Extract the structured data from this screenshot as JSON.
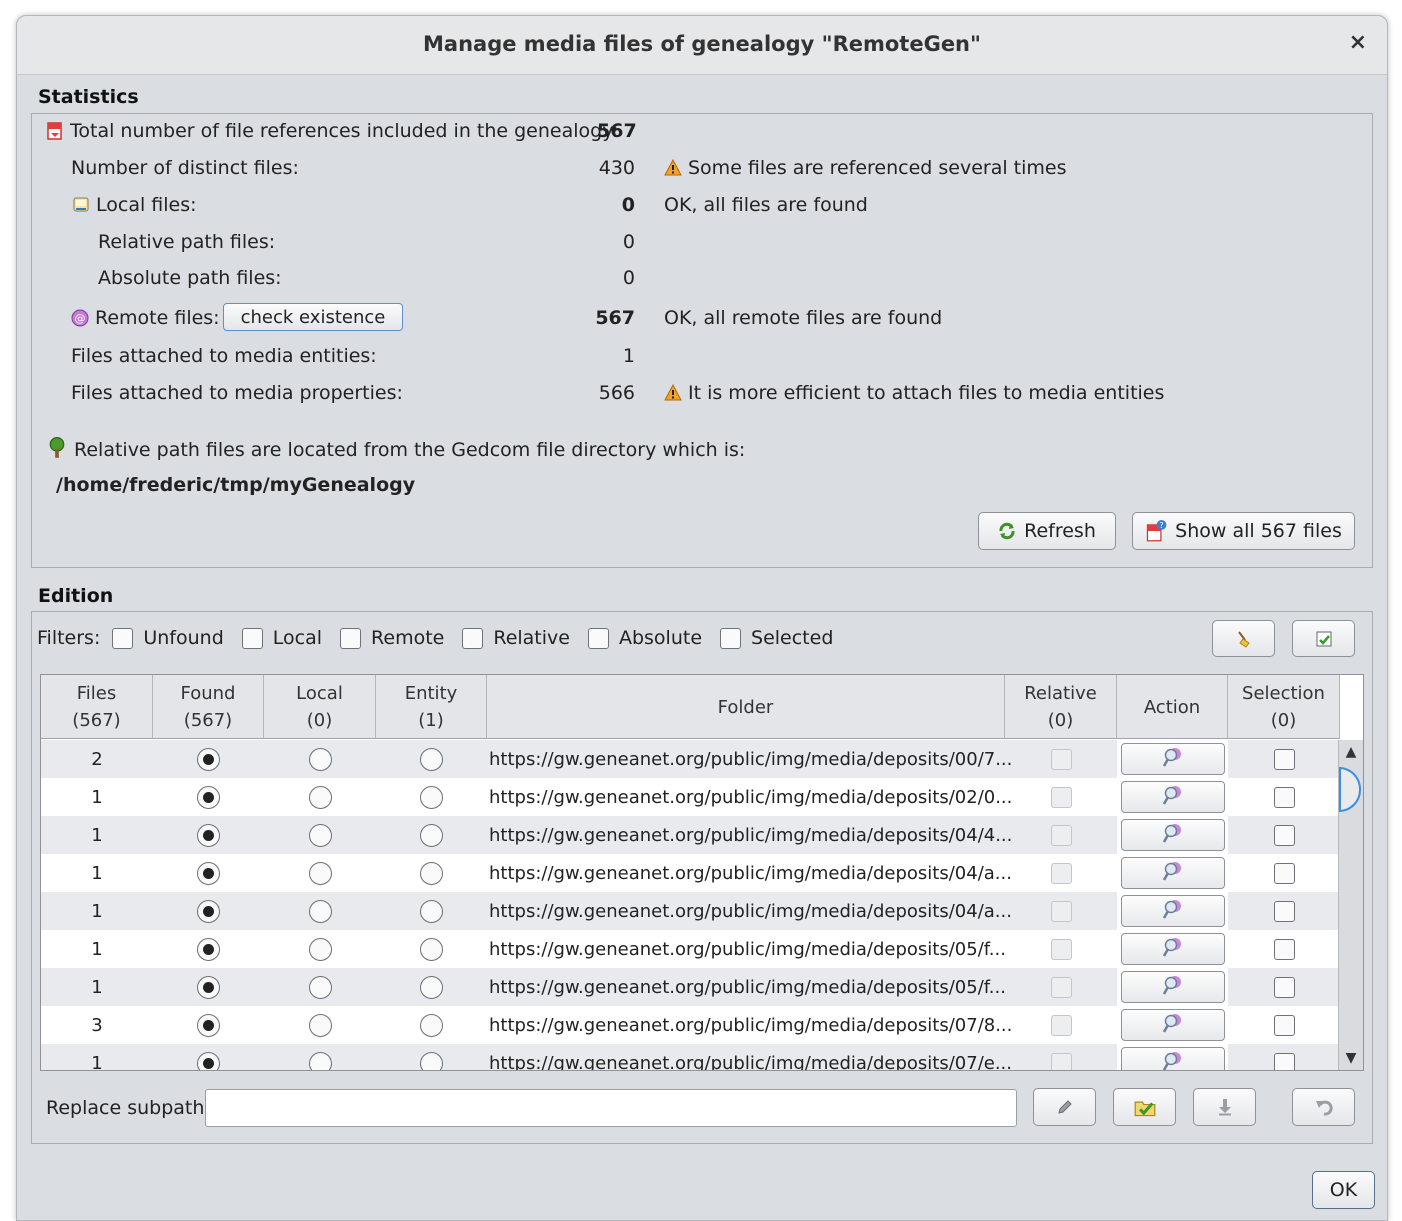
{
  "window": {
    "title": "Manage media files of genealogy \"RemoteGen\"",
    "close_glyph": "×"
  },
  "statistics": {
    "section_title": "Statistics",
    "total": {
      "label": "Total number of file references included in the genealogy:",
      "value": "567"
    },
    "distinct": {
      "label": "Number of distinct files:",
      "value": "430",
      "note": "Some files are referenced several times"
    },
    "local": {
      "label": "Local files:",
      "value": "0",
      "note": "OK, all files are found"
    },
    "relative": {
      "label": "Relative path files:",
      "value": "0"
    },
    "absolute": {
      "label": "Absolute path files:",
      "value": "0"
    },
    "remote": {
      "label": "Remote files:",
      "button": "check existence",
      "value": "567",
      "note": "OK, all remote files are found"
    },
    "entities": {
      "label": "Files attached to media entities:",
      "value": "1"
    },
    "properties": {
      "label": "Files attached to media properties:",
      "value": "566",
      "note": "It is more efficient to attach files to media entities"
    },
    "gedcom_note": "Relative path files are located from the Gedcom file directory which is:",
    "gedcom_dir": "/home/frederic/tmp/myGenealogy",
    "refresh_label": "Refresh",
    "show_all_label": "Show all 567 files"
  },
  "edition": {
    "section_title": "Edition",
    "filters_label": "Filters:",
    "filters": [
      "Unfound",
      "Local",
      "Remote",
      "Relative",
      "Absolute",
      "Selected"
    ],
    "columns": [
      {
        "name": "Files",
        "count": "(567)"
      },
      {
        "name": "Found",
        "count": "(567)"
      },
      {
        "name": "Local",
        "count": "(0)"
      },
      {
        "name": "Entity",
        "count": "(1)"
      },
      {
        "name": "Folder",
        "count": ""
      },
      {
        "name": "Relative",
        "count": "(0)"
      },
      {
        "name": "Action",
        "count": ""
      },
      {
        "name": "Selection",
        "count": "(0)"
      }
    ],
    "rows": [
      {
        "files": "2",
        "folder": "https://gw.geneanet.org/public/img/media/deposits/00/7..."
      },
      {
        "files": "1",
        "folder": "https://gw.geneanet.org/public/img/media/deposits/02/0..."
      },
      {
        "files": "1",
        "folder": "https://gw.geneanet.org/public/img/media/deposits/04/4..."
      },
      {
        "files": "1",
        "folder": "https://gw.geneanet.org/public/img/media/deposits/04/a..."
      },
      {
        "files": "1",
        "folder": "https://gw.geneanet.org/public/img/media/deposits/04/a..."
      },
      {
        "files": "1",
        "folder": "https://gw.geneanet.org/public/img/media/deposits/05/f..."
      },
      {
        "files": "1",
        "folder": "https://gw.geneanet.org/public/img/media/deposits/05/f..."
      },
      {
        "files": "3",
        "folder": "https://gw.geneanet.org/public/img/media/deposits/07/8..."
      },
      {
        "files": "1",
        "folder": "https://gw.geneanet.org/public/img/media/deposits/07/e..."
      }
    ],
    "replace_label": "Replace subpath",
    "replace_value": ""
  },
  "ok_label": "OK",
  "icons": {
    "total": "red-file-icon",
    "warning": "warning-triangle-icon",
    "local": "local-drive-icon",
    "remote": "at-sign-icon",
    "tree": "tree-icon",
    "refresh": "refresh-icon",
    "show_all": "file-info-icon",
    "clear": "broom-icon",
    "select": "checkmark-file-icon",
    "action": "magnifier-icon",
    "edit": "pencil-icon",
    "browse": "folder-check-icon",
    "download": "download-arrow-icon",
    "undo": "undo-icon"
  }
}
